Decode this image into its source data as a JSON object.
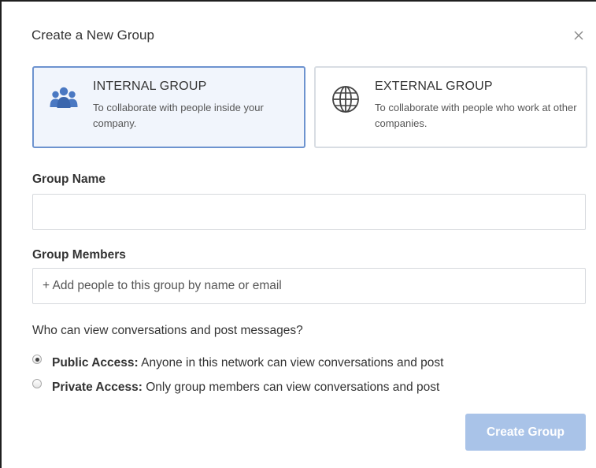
{
  "dialog": {
    "title": "Create a New Group"
  },
  "group_types": {
    "internal": {
      "title": "INTERNAL GROUP",
      "description": "To collaborate with people inside your company.",
      "icon": "people-icon",
      "selected": true
    },
    "external": {
      "title": "EXTERNAL GROUP",
      "description": "To collaborate with people who work at other companies.",
      "icon": "globe-icon",
      "selected": false
    }
  },
  "form": {
    "group_name": {
      "label": "Group Name",
      "value": "",
      "placeholder": ""
    },
    "group_members": {
      "label": "Group Members",
      "value": "",
      "placeholder": "+ Add people to this group by name or email"
    },
    "access": {
      "question": "Who can view conversations and post messages?",
      "options": [
        {
          "title": "Public Access:",
          "description": "Anyone in this network can view conversations and post",
          "selected": true
        },
        {
          "title": "Private Access:",
          "description": "Only group members can view conversations and post",
          "selected": false
        }
      ]
    }
  },
  "actions": {
    "create_label": "Create Group"
  },
  "colors": {
    "accent_border": "#6d93cf",
    "selected_card_bg": "#f1f5fc",
    "icon_blue": "#4a78c2",
    "button_disabled": "#a9c3e8"
  }
}
